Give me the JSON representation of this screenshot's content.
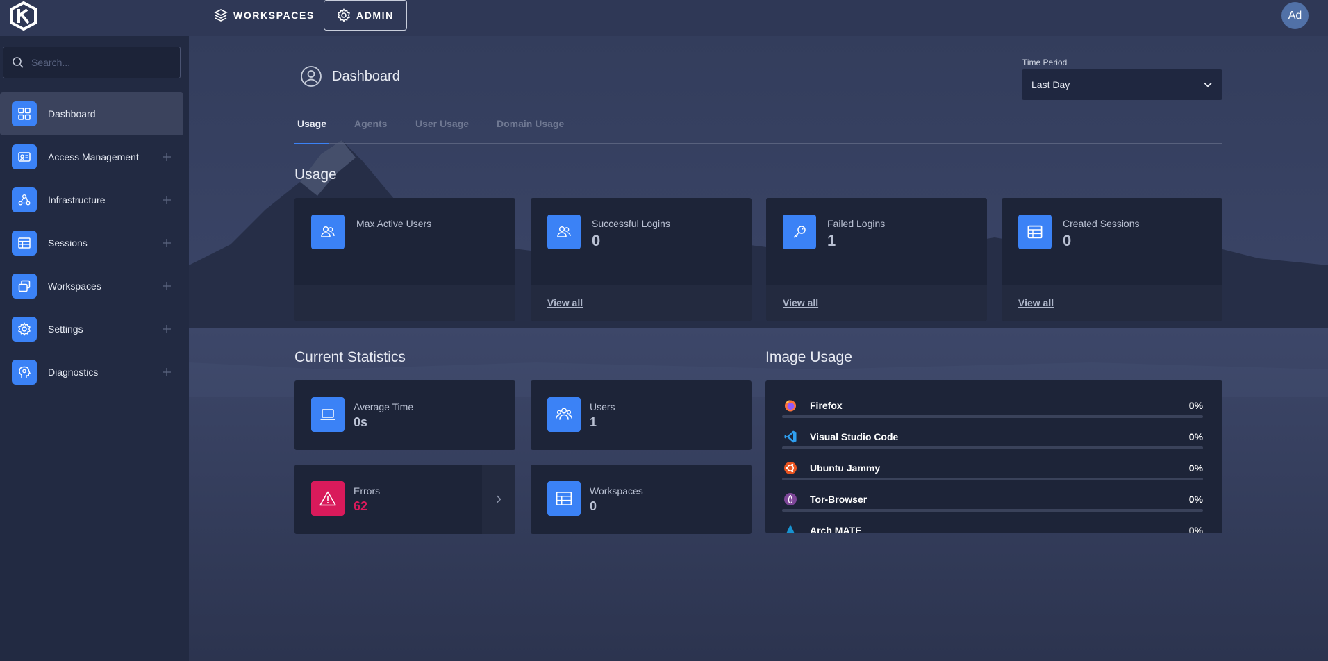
{
  "topbar": {
    "nav": [
      {
        "label": "WORKSPACES",
        "icon": "layers-icon"
      },
      {
        "label": "ADMIN",
        "icon": "gear-icon"
      }
    ],
    "avatar_initials": "Ad"
  },
  "sidebar": {
    "search_placeholder": "Search...",
    "items": [
      {
        "label": "Dashboard",
        "icon": "dashboard-grid-icon",
        "active": true
      },
      {
        "label": "Access Management",
        "icon": "id-card-icon"
      },
      {
        "label": "Infrastructure",
        "icon": "webhook-icon"
      },
      {
        "label": "Sessions",
        "icon": "table-icon"
      },
      {
        "label": "Workspaces",
        "icon": "windows-stack-icon"
      },
      {
        "label": "Settings",
        "icon": "gear-icon"
      },
      {
        "label": "Diagnostics",
        "icon": "head-icon"
      }
    ]
  },
  "page": {
    "title": "Dashboard",
    "time_period_label": "Time Period",
    "time_period_value": "Last Day"
  },
  "tabs": [
    "Usage",
    "Agents",
    "User Usage",
    "Domain Usage"
  ],
  "usage": {
    "title": "Usage",
    "cards": [
      {
        "label": "Max Active Users",
        "value": "",
        "icon": "users-icon",
        "view_all": ""
      },
      {
        "label": "Successful Logins",
        "value": "0",
        "icon": "users-icon",
        "view_all": "View all"
      },
      {
        "label": "Failed Logins",
        "value": "1",
        "icon": "key-icon",
        "view_all": "View all"
      },
      {
        "label": "Created Sessions",
        "value": "0",
        "icon": "table-icon",
        "view_all": "View all"
      }
    ]
  },
  "current_statistics": {
    "title": "Current Statistics",
    "stats": [
      {
        "label": "Average Time",
        "value": "0s",
        "icon": "laptop-icon"
      },
      {
        "label": "Users",
        "value": "1",
        "icon": "users-icon"
      },
      {
        "label": "Errors",
        "value": "62",
        "icon": "warning-icon",
        "color": "#d91a5b"
      },
      {
        "label": "Workspaces",
        "value": "0",
        "icon": "table-icon"
      }
    ]
  },
  "image_usage": {
    "title": "Image Usage",
    "images": [
      {
        "name": "Firefox",
        "percent": "0%",
        "fraction": 0,
        "icon": "firefox-icon"
      },
      {
        "name": "Visual Studio Code",
        "percent": "0%",
        "fraction": 0,
        "icon": "vscode-icon"
      },
      {
        "name": "Ubuntu Jammy",
        "percent": "0%",
        "fraction": 0,
        "icon": "ubuntu-icon"
      },
      {
        "name": "Tor-Browser",
        "percent": "0%",
        "fraction": 0,
        "icon": "tor-icon"
      },
      {
        "name": "Arch MATE",
        "percent": "0%",
        "fraction": 0,
        "icon": "arch-icon"
      }
    ]
  },
  "colors": {
    "accent": "#3b82f6",
    "error": "#d91a5b"
  }
}
